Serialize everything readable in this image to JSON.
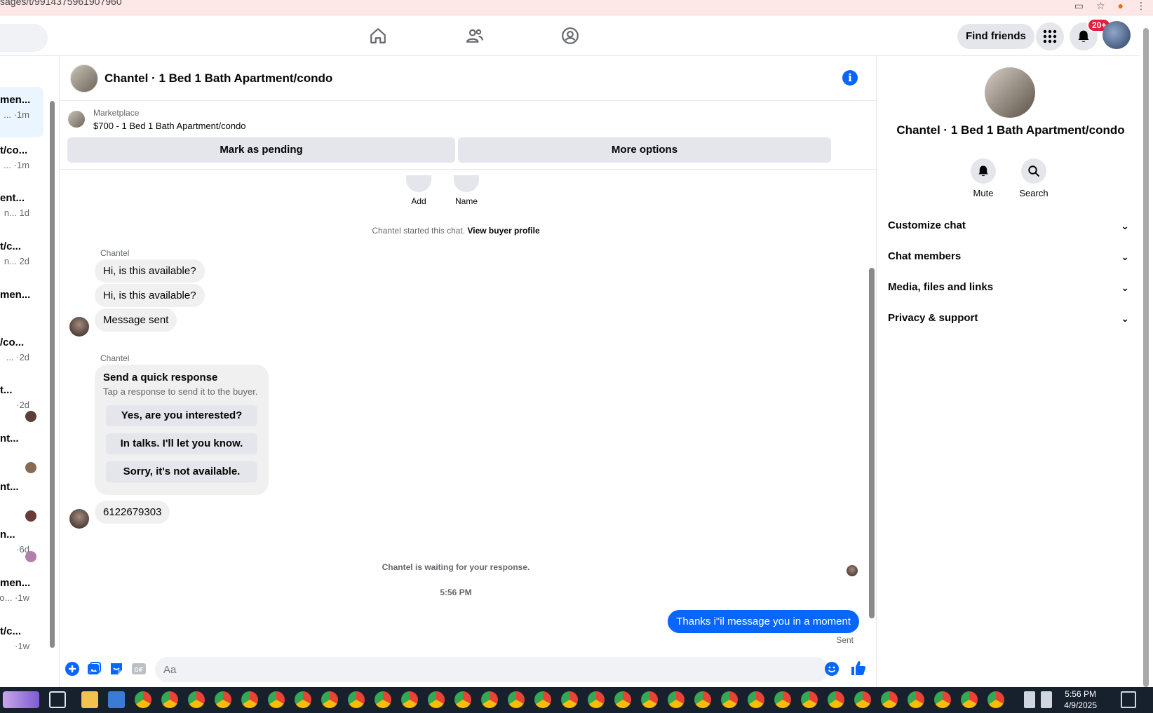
{
  "browser": {
    "url_fragment": "sages/t/9914375961907960"
  },
  "topnav": {
    "find_friends": "Find friends",
    "notification_badge": "20+"
  },
  "left_list": [
    {
      "title": "men...",
      "subtitle": "... ·1m",
      "active": true
    },
    {
      "title": "t/co...",
      "subtitle": "... ·1m"
    },
    {
      "title": "ent...",
      "subtitle": "n... 1d"
    },
    {
      "title": "t/c...",
      "subtitle": "n... 2d"
    },
    {
      "title": "men...",
      "subtitle": ""
    },
    {
      "title": "/co...",
      "subtitle": "... ·2d"
    },
    {
      "title": "t...",
      "subtitle": "·2d"
    },
    {
      "title": "nt...",
      "subtitle": ""
    },
    {
      "title": "nt...",
      "subtitle": ""
    },
    {
      "title": "n...",
      "subtitle": "·6d"
    },
    {
      "title": "men...",
      "subtitle": "o... ·1w"
    },
    {
      "title": "t/c...",
      "subtitle": "·1w"
    }
  ],
  "chat": {
    "title": "Chantel · 1 Bed 1 Bath Apartment/condo",
    "marketplace_label": "Marketplace",
    "listing": "$700 - 1 Bed 1 Bath Apartment/condo",
    "mark_pending": "Mark as pending",
    "more_options": "More options",
    "top_actions": {
      "add": "Add",
      "name": "Name"
    },
    "started": "Chantel started this chat.",
    "view_profile": "View buyer profile",
    "sender": "Chantel",
    "msg1": "Hi, is this available?",
    "msg2": "Hi, is this available?",
    "msg3": "Message sent",
    "quick_title": "Send a quick response",
    "quick_sub": "Tap a response to send it to the buyer.",
    "quick_options": [
      "Yes, are you interested?",
      "In talks. I'll let you know.",
      "Sorry, it's not available."
    ],
    "phone": "6122679303",
    "waiting": "Chantel is waiting for your response.",
    "time": "5:56 PM",
    "outgoing": "Thanks i\"il message you in a moment",
    "sent_label": "Sent",
    "input_placeholder": "Aa"
  },
  "right_panel": {
    "name": "Chantel · 1 Bed 1 Bath Apartment/condo",
    "mute": "Mute",
    "search": "Search",
    "sections": [
      "Customize chat",
      "Chat members",
      "Media, files and links",
      "Privacy & support"
    ]
  },
  "taskbar": {
    "time": "5:56 PM",
    "date": "4/9/2025"
  },
  "colors": {
    "accent": "#0866ff",
    "badge": "#e41e3f",
    "taskbar": "#17212d"
  }
}
